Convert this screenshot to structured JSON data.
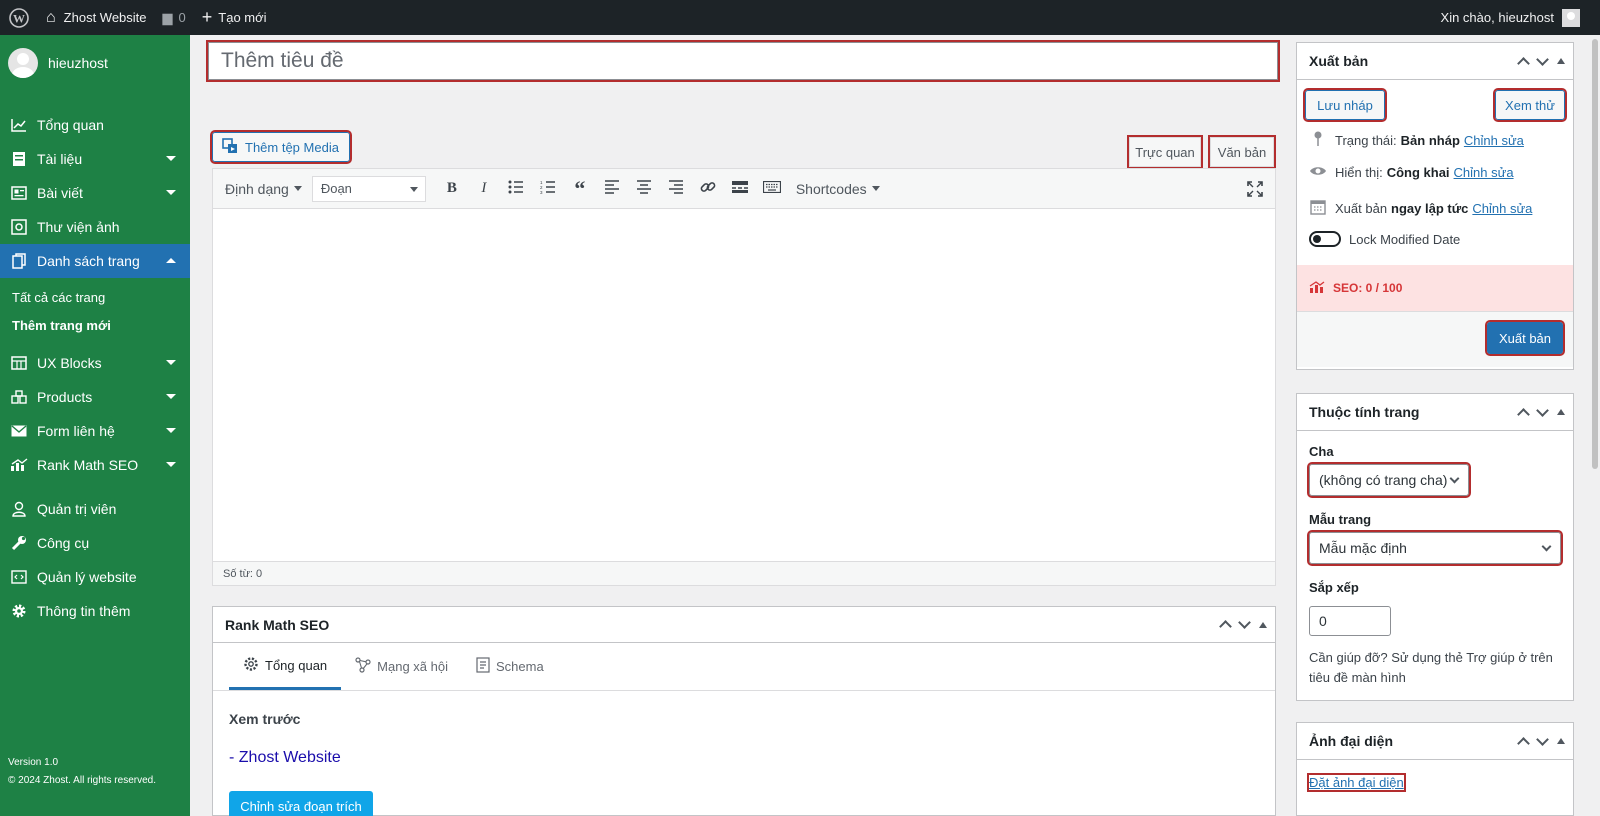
{
  "adminbar": {
    "site_name": "Zhost Website",
    "comments_count": "0",
    "new_label": "Tạo mới",
    "greeting": "Xin chào, hieuzhost"
  },
  "sidebar": {
    "username": "hieuzhost",
    "items": [
      {
        "label": "Tổng quan",
        "icon": "dashboard-icon"
      },
      {
        "label": "Tài liệu",
        "icon": "document-icon"
      },
      {
        "label": "Bài viết",
        "icon": "posts-icon"
      },
      {
        "label": "Thư viện ảnh",
        "icon": "media-icon"
      },
      {
        "label": "Danh sách trang",
        "icon": "pages-icon"
      },
      {
        "label": "UX Blocks",
        "icon": "blocks-icon"
      },
      {
        "label": "Products",
        "icon": "products-icon"
      },
      {
        "label": "Form liên hệ",
        "icon": "mail-icon"
      },
      {
        "label": "Rank Math SEO",
        "icon": "rankmath-icon"
      },
      {
        "label": "Quản trị viên",
        "icon": "user-icon"
      },
      {
        "label": "Công cụ",
        "icon": "wrench-icon"
      },
      {
        "label": "Quản lý website",
        "icon": "website-icon"
      },
      {
        "label": "Thông tin thêm",
        "icon": "gear-icon"
      }
    ],
    "submenu": [
      "Tất cả các trang",
      "Thêm trang mới"
    ],
    "version": "Version 1.0",
    "copyright": "© 2024 Zhost. All rights reserved."
  },
  "editor": {
    "title_placeholder": "Thêm tiêu đề",
    "add_media": "Thêm tệp Media",
    "tab_visual": "Trực quan",
    "tab_text": "Văn bản",
    "format_label": "Định dạng",
    "block_select": "Đoạn",
    "shortcodes": "Shortcodes",
    "word_count": "Số từ: 0"
  },
  "rankmath": {
    "title": "Rank Math SEO",
    "tabs": [
      "Tổng quan",
      "Mạng xã hội",
      "Schema"
    ],
    "preview_label": "Xem trước",
    "site_title": "- Zhost Website",
    "edit_snippet": "Chỉnh sửa đoạn trích"
  },
  "publish": {
    "title": "Xuất bản",
    "save_draft": "Lưu nháp",
    "preview": "Xem thử",
    "status_label": "Trạng thái:",
    "status_value": "Bản nháp",
    "visibility_label": "Hiển thị:",
    "visibility_value": "Công khai",
    "schedule_label": "Xuất bản",
    "schedule_value": "ngay lập tức",
    "edit_link": "Chỉnh sửa",
    "lock_modified": "Lock Modified Date",
    "seo_score": "SEO: 0 / 100",
    "publish_button": "Xuất bản"
  },
  "page_attributes": {
    "title": "Thuộc tính trang",
    "parent_label": "Cha",
    "parent_value": "(không có trang cha)",
    "template_label": "Mẫu trang",
    "template_value": "Mẫu mặc định",
    "order_label": "Sắp xếp",
    "order_value": "0",
    "help_text": "Cần giúp đỡ? Sử dụng thẻ Trợ giúp ở trên tiêu đề màn hình"
  },
  "featured_image": {
    "title": "Ảnh đại diện",
    "set_link": "Đặt ảnh đại diện"
  },
  "colors": {
    "sidebar": "#1e8145",
    "active": "#2271b1",
    "adminbar": "#1d2327",
    "highlight": "#b32d2e"
  }
}
